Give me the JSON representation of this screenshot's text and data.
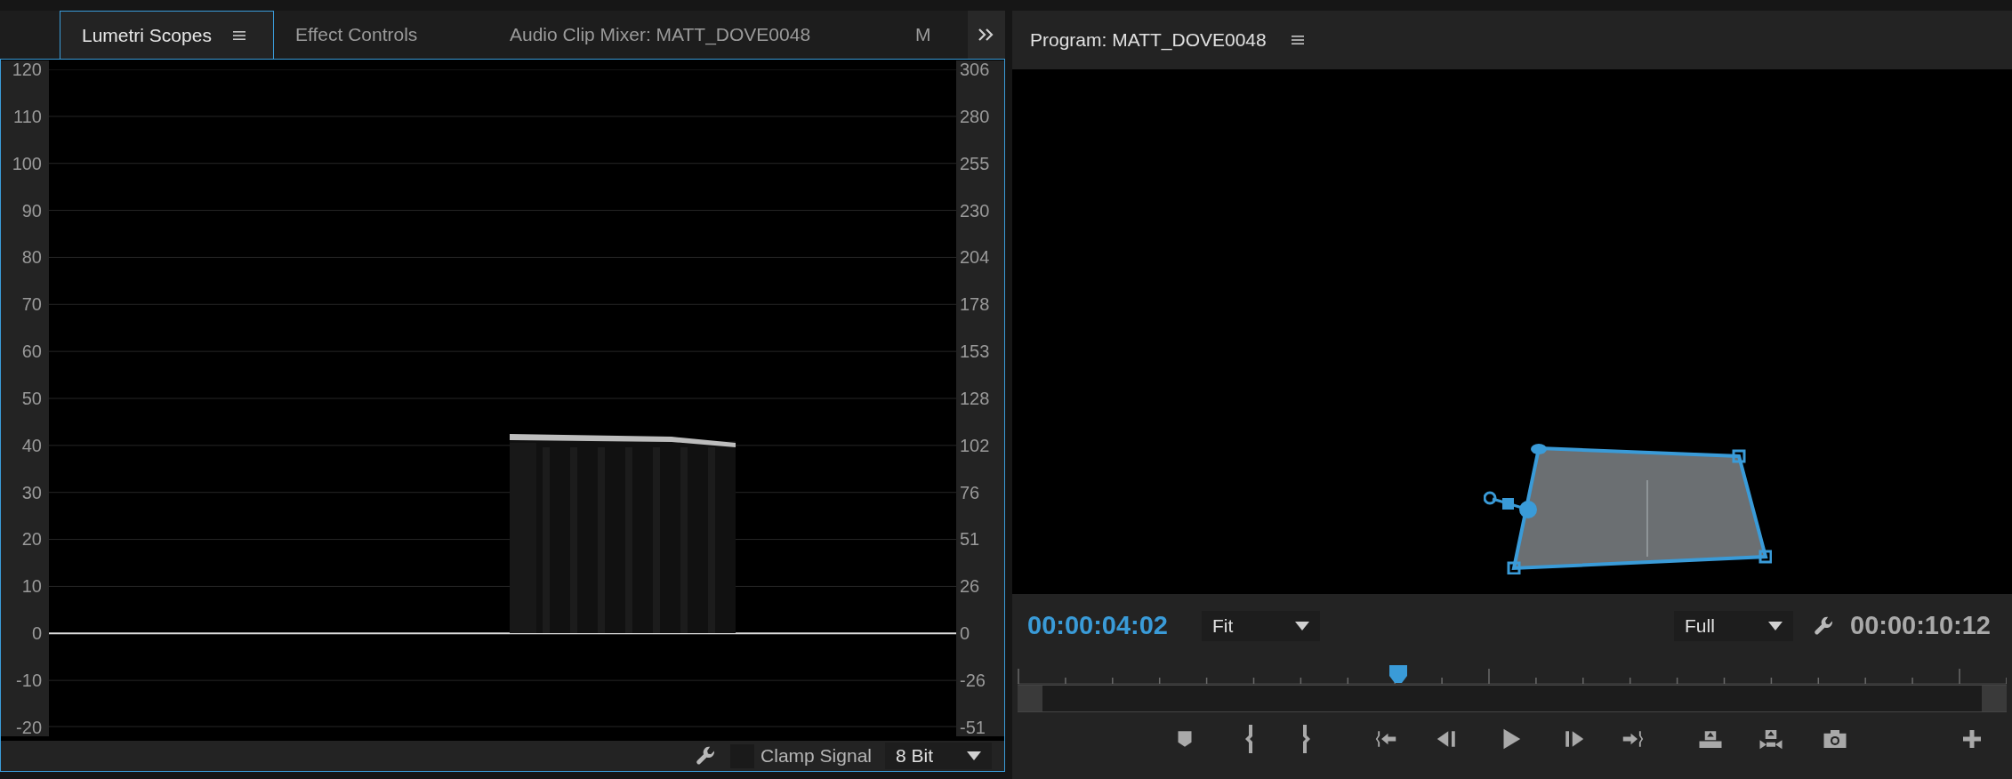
{
  "scopes_panel": {
    "tabs": [
      {
        "label": "Lumetri Scopes",
        "selected": true
      },
      {
        "label": "Effect Controls",
        "selected": false
      },
      {
        "label": "Audio Clip Mixer: MATT_DOVE0048",
        "selected": false
      },
      {
        "label": "M",
        "selected": false
      }
    ],
    "left_scale": [
      "120",
      "110",
      "100",
      "90",
      "80",
      "70",
      "60",
      "50",
      "40",
      "30",
      "20",
      "10",
      "0",
      "-10",
      "-20"
    ],
    "right_scale": [
      "306",
      "280",
      "255",
      "230",
      "204",
      "178",
      "153",
      "128",
      "102",
      "76",
      "51",
      "26",
      "0",
      "-26",
      "-51"
    ],
    "toolbar": {
      "clamp_signal": {
        "label": "Clamp Signal",
        "checked": false
      },
      "bit_depth": "8 Bit"
    }
  },
  "program_monitor": {
    "title": "Program: MATT_DOVE0048",
    "current_time": "00:00:04:02",
    "zoom": "Fit",
    "resolution": "Full",
    "duration": "00:00:10:12",
    "playhead": {
      "level": 0.385
    }
  }
}
